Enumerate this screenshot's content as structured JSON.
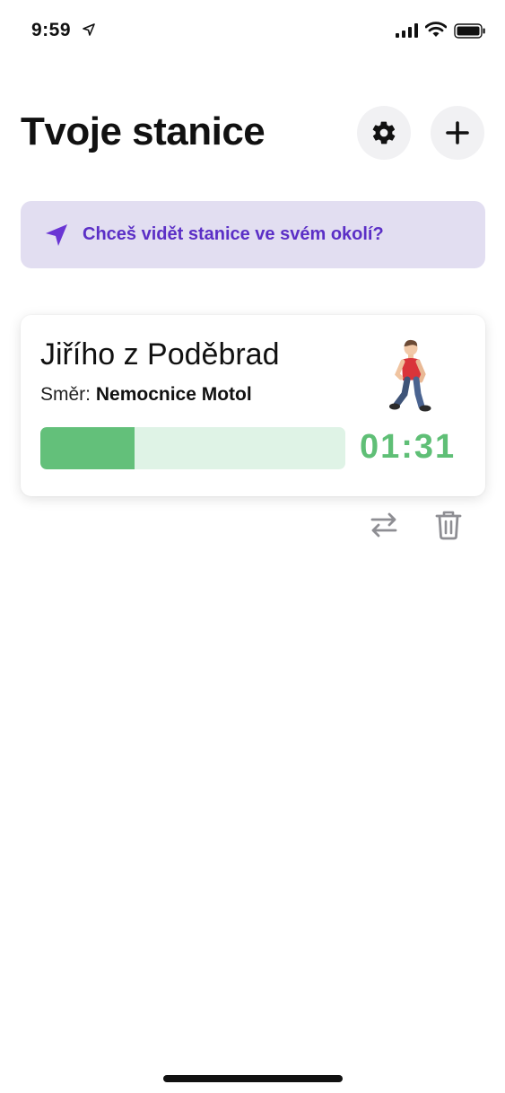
{
  "status_bar": {
    "time": "9:59",
    "icons": [
      "location-arrow-icon",
      "cellular-signal-icon",
      "wifi-icon",
      "battery-icon"
    ]
  },
  "header": {
    "title": "Tvoje stanice",
    "settings_icon": "gear-icon",
    "add_icon": "plus-icon"
  },
  "location_banner": {
    "icon": "navigation-arrow-icon",
    "text": "Chceš vidět stanice ve svém okolí?",
    "accent_color": "#5b2fc6",
    "background_color": "#e2def1"
  },
  "stations": [
    {
      "name": "Jiřího z Poděbrad",
      "direction_label": "Směr:",
      "direction": "Nemocnice Motol",
      "mode_icon": "person-walking-icon",
      "countdown": "01:31",
      "progress": 0.31,
      "progress_color": "#63c07a",
      "actions": [
        {
          "icon": "swap-arrows-icon"
        },
        {
          "icon": "trash-icon"
        }
      ]
    }
  ]
}
